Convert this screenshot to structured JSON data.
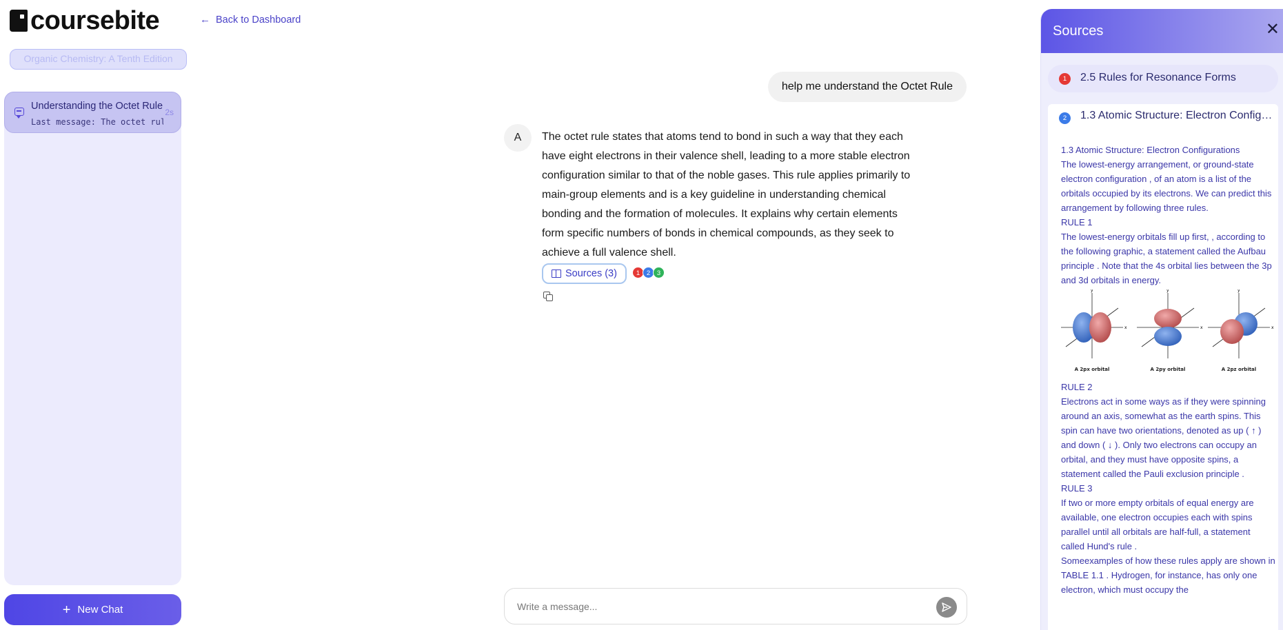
{
  "app": {
    "logo_text": "coursebite"
  },
  "sidebar": {
    "course": "Organic Chemistry: A Tenth Edition",
    "chats": [
      {
        "title": "Understanding the Octet Rule",
        "last_message": "Last message: The octet rule states that atoms",
        "time": "2s"
      }
    ],
    "new_chat_label": "New Chat"
  },
  "header": {
    "back_label": "Back to Dashboard"
  },
  "conversation": {
    "user_message": "help me understand the Octet Rule",
    "assistant_avatar": "A",
    "assistant_message": "The octet rule states that atoms tend to bond in such a way that they each have eight electrons in their valence shell, leading to a more stable electron configuration similar to that of the noble gases. This rule applies primarily to main-group elements and is a key guideline in understanding chemical bonding and the formation of molecules. It explains why certain elements form specific numbers of bonds in chemical compounds, as they seek to achieve a full valence shell.",
    "sources_button": "Sources (3)",
    "source_dots": [
      {
        "n": "1",
        "color": "#e53935"
      },
      {
        "n": "2",
        "color": "#3b7be8"
      },
      {
        "n": "3",
        "color": "#2fb35a"
      }
    ]
  },
  "composer": {
    "placeholder": "Write a message..."
  },
  "panel": {
    "title": "Sources",
    "sources": [
      {
        "n": "1",
        "color": "#e53935",
        "title": "2.5 Rules for Resonance Forms"
      },
      {
        "n": "2",
        "color": "#3b7be8",
        "title": "1.3 Atomic Structure: Electron Configurations"
      }
    ],
    "open_source": {
      "heading": "1.3 Atomic Structure: Electron Configurations",
      "p1": "The lowest-energy arrangement, or ground-state electron configuration , of an atom is a list of the orbitals occupied by its electrons. We can predict this arrangement by following three rules.",
      "rule1": "RULE 1",
      "p2": "The lowest-energy orbitals fill up first, , according to the following graphic, a statement called the Aufbau principle . Note that the 4s orbital lies between the 3p and 3d orbitals in energy.",
      "orbital_captions": [
        "A 2px orbital",
        "A 2py orbital",
        "A 2pz orbital"
      ],
      "rule2": "RULE 2",
      "p3": "Electrons act in some ways as if they were spinning around an axis, somewhat as the earth spins. This spin can have two orientations, denoted as up ( ↑ ) and down ( ↓ ). Only two electrons can occupy an orbital, and they must have opposite spins, a statement called the Pauli exclusion principle .",
      "rule3": "RULE 3",
      "p4": "If two or more empty orbitals of equal energy are available, one electron occupies each with spins parallel until all orbitals are half-full, a statement called Hund's rule .",
      "p5": "Someexamples of how these rules apply are shown in TABLE 1.1 . Hydrogen, for instance, has only one electron, which must occupy the"
    }
  }
}
